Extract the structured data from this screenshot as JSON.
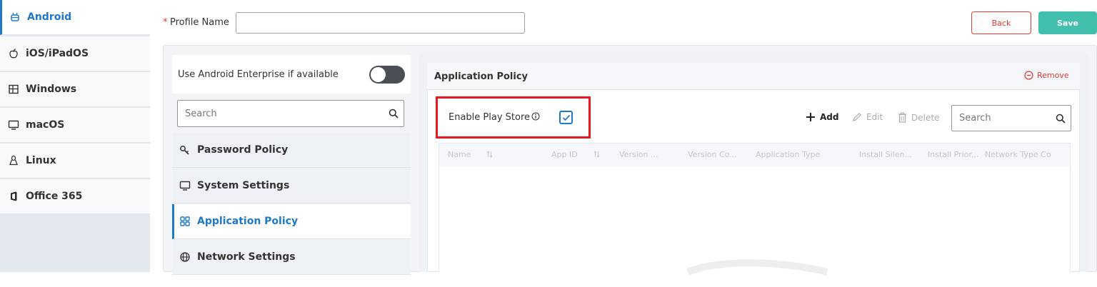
{
  "os_sidebar": {
    "items": [
      {
        "label": "Android",
        "icon": "android-icon"
      },
      {
        "label": "iOS/iPadOS",
        "icon": "apple-icon"
      },
      {
        "label": "Windows",
        "icon": "windows-icon"
      },
      {
        "label": "macOS",
        "icon": "monitor-icon"
      },
      {
        "label": "Linux",
        "icon": "linux-icon"
      },
      {
        "label": "Office 365",
        "icon": "office-icon"
      }
    ],
    "active_index": 0
  },
  "header": {
    "required_mark": "*",
    "profile_label": "Profile Name",
    "profile_value": "",
    "back_label": "Back",
    "save_label": "Save"
  },
  "left_panel": {
    "enterprise_label": "Use Android Enterprise if available",
    "enterprise_enabled": false,
    "search_placeholder": "Search",
    "policies": [
      {
        "label": "Password Policy",
        "icon": "key-icon"
      },
      {
        "label": "System Settings",
        "icon": "monitor-icon"
      },
      {
        "label": "Application Policy",
        "icon": "apps-grid-icon"
      },
      {
        "label": "Network Settings",
        "icon": "globe-icon"
      }
    ],
    "active_index": 2
  },
  "app_policy": {
    "title": "Application Policy",
    "remove_label": "Remove",
    "enable_play_store_label": "Enable Play Store",
    "enable_play_store_checked": true,
    "add_label": "Add",
    "edit_label": "Edit",
    "delete_label": "Delete",
    "search_placeholder": "Search",
    "columns": [
      "Name",
      "App ID",
      "Version ...",
      "Version Co...",
      "Application Type",
      "Install Silen...",
      "Install Prior...",
      "Network Type Co"
    ]
  },
  "colors": {
    "accent": "#1f78c8",
    "danger": "#e53935",
    "save": "#43bfae",
    "highlight": "#e8181e"
  }
}
